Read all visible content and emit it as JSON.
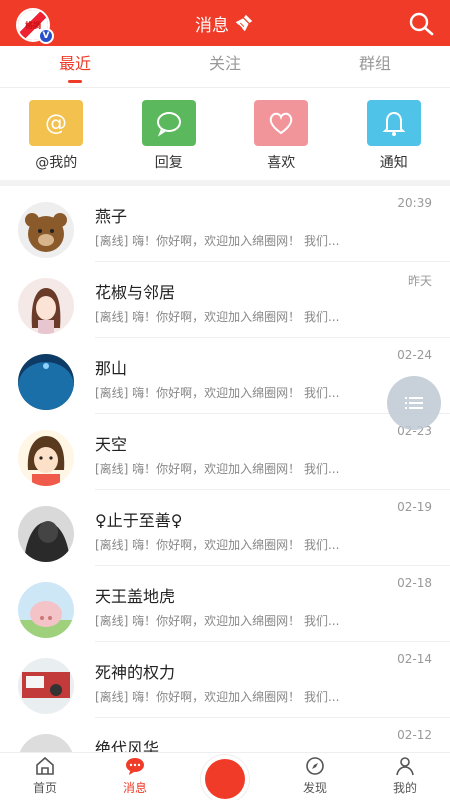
{
  "header": {
    "title": "消息",
    "avatar_text": "格調",
    "badge": "V"
  },
  "tabs": [
    {
      "label": "最近",
      "active": true
    },
    {
      "label": "关注",
      "active": false
    },
    {
      "label": "群组",
      "active": false
    }
  ],
  "quick_actions": [
    {
      "label": "@我的",
      "color": "#f2c14e",
      "icon": "at-icon"
    },
    {
      "label": "回复",
      "color": "#5cb85c",
      "icon": "chat-bubble-icon"
    },
    {
      "label": "喜欢",
      "color": "#f2959b",
      "icon": "heart-icon"
    },
    {
      "label": "通知",
      "color": "#4fc3e8",
      "icon": "bell-icon"
    }
  ],
  "messages": [
    {
      "name": "燕子",
      "preview": "[离线] 嗨！你好啊，欢迎加入绵圈网！ 我们...",
      "time": "20:39"
    },
    {
      "name": "花椒与邻居",
      "preview": "[离线] 嗨！你好啊，欢迎加入绵圈网！ 我们...",
      "time": "昨天"
    },
    {
      "name": "那山",
      "preview": "[离线] 嗨！你好啊，欢迎加入绵圈网！ 我们...",
      "time": "02-24"
    },
    {
      "name": "天空",
      "preview": "[离线] 嗨！你好啊，欢迎加入绵圈网！ 我们...",
      "time": "02-23"
    },
    {
      "name": "♀止于至善♀",
      "preview": "[离线] 嗨！你好啊，欢迎加入绵圈网！ 我们...",
      "time": "02-19"
    },
    {
      "name": "天王盖地虎",
      "preview": "[离线] 嗨！你好啊，欢迎加入绵圈网！ 我们...",
      "time": "02-18"
    },
    {
      "name": "死神的权力",
      "preview": "[离线] 嗨！你好啊，欢迎加入绵圈网！ 我们...",
      "time": "02-14"
    },
    {
      "name": "绝代风华",
      "preview": "",
      "time": "02-12"
    }
  ],
  "bottom_nav": [
    {
      "label": "首页",
      "icon": "home-icon",
      "active": false
    },
    {
      "label": "消息",
      "icon": "message-icon",
      "active": true
    },
    {
      "label": "",
      "icon": "publish-button",
      "active": false
    },
    {
      "label": "发现",
      "icon": "compass-icon",
      "active": false
    },
    {
      "label": "我的",
      "icon": "user-icon",
      "active": false
    }
  ],
  "colors": {
    "brand": "#ef3b28"
  }
}
